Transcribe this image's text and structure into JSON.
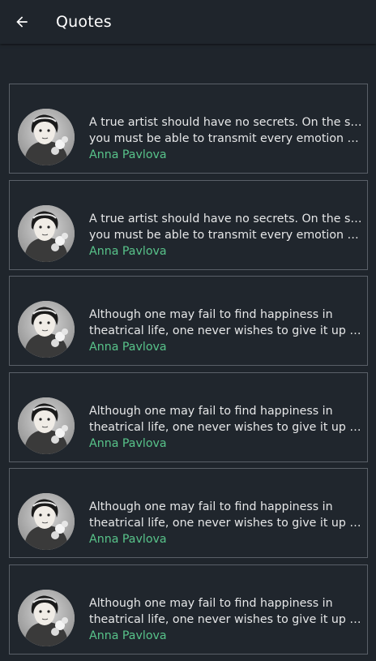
{
  "appbar": {
    "title": "Quotes",
    "back_icon": "arrow-left-icon"
  },
  "colors": {
    "background": "#1f252c",
    "card_border": "#5a6068",
    "author": "#58c38a",
    "text": "#e6e7e8"
  },
  "quotes": [
    {
      "line1": "A true artist should have no secrets. On the stage,",
      "line2": "you must be able to transmit every emotion to th…",
      "author": "Anna Pavlova"
    },
    {
      "line1": "A true artist should have no secrets. On the stage,",
      "line2": "you must be able to transmit every emotion to th…",
      "author": "Anna Pavlova"
    },
    {
      "line1": "Although one may fail to find happiness in",
      "line2": "theatrical life, one never wishes to give it up after…",
      "author": "Anna Pavlova"
    },
    {
      "line1": "Although one may fail to find happiness in",
      "line2": "theatrical life, one never wishes to give it up after…",
      "author": "Anna Pavlova"
    },
    {
      "line1": "Although one may fail to find happiness in",
      "line2": "theatrical life, one never wishes to give it up after…",
      "author": "Anna Pavlova"
    },
    {
      "line1": "Although one may fail to find happiness in",
      "line2": "theatrical life, one never wishes to give it up after…",
      "author": "Anna Pavlova"
    }
  ]
}
